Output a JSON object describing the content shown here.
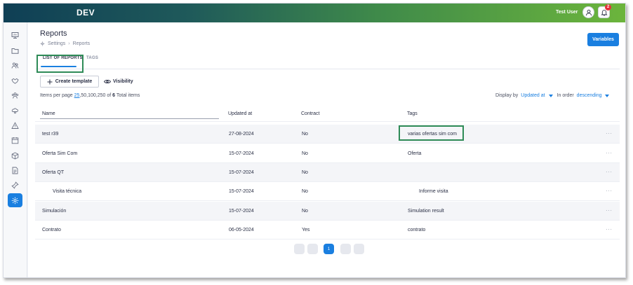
{
  "app": {
    "env_label": "DEV",
    "user_name": "Test User",
    "notification_count": "2",
    "accent_color": "#1a7fe0"
  },
  "sidebar": {
    "icons": [
      "dashboard-icon",
      "folder-icon",
      "users-icon",
      "handshake-icon",
      "team-icon",
      "cloud-settings-icon",
      "warning-icon",
      "calendar-icon",
      "box-icon",
      "document-icon",
      "pin-icon",
      "settings-icon"
    ],
    "active_index": 11
  },
  "page": {
    "title": "Reports",
    "breadcrumb": [
      "Settings",
      "Reports"
    ],
    "variables_button": "Variables"
  },
  "tabs": [
    {
      "label": "LIST OF REPORTS",
      "active": true
    },
    {
      "label": "TAGS",
      "active": false
    }
  ],
  "toolbar": {
    "create_label": "Create template",
    "visibility_label": "Visibility"
  },
  "pagination_info": {
    "prefix": "Items per page",
    "current": "25",
    "options": ",50,100,250 of",
    "total": "6",
    "suffix": "Total items"
  },
  "sort": {
    "display_by_label": "Display by",
    "display_by_value": "Updated at",
    "order_label": "In order",
    "order_value": "descending"
  },
  "table": {
    "columns": [
      "Name",
      "Updated at",
      "Contract",
      "Tags"
    ],
    "rows": [
      {
        "name": "test r39",
        "updated": "27-08-2024",
        "contract": "No",
        "tags": "varias ofertas sim com",
        "indent": false,
        "tag_indent": false
      },
      {
        "name": "Oferta Sim Com",
        "updated": "15-07-2024",
        "contract": "No",
        "tags": "Oferta",
        "indent": false,
        "tag_indent": false
      },
      {
        "name": "Oferta QT",
        "updated": "15-07-2024",
        "contract": "No",
        "tags": "",
        "indent": false,
        "tag_indent": false
      },
      {
        "name": "Visita técnica",
        "updated": "15-07-2024",
        "contract": "No",
        "tags": "Informe visita",
        "indent": true,
        "tag_indent": true
      },
      {
        "name": "Simulación",
        "updated": "15-07-2024",
        "contract": "No",
        "tags": "Simulation result",
        "indent": false,
        "tag_indent": false
      },
      {
        "name": "Contrato",
        "updated": "06-05-2024",
        "contract": "Yes",
        "tags": "contrato",
        "indent": false,
        "tag_indent": false
      }
    ],
    "row_menu": "···"
  },
  "pager": {
    "current_page": "1"
  }
}
